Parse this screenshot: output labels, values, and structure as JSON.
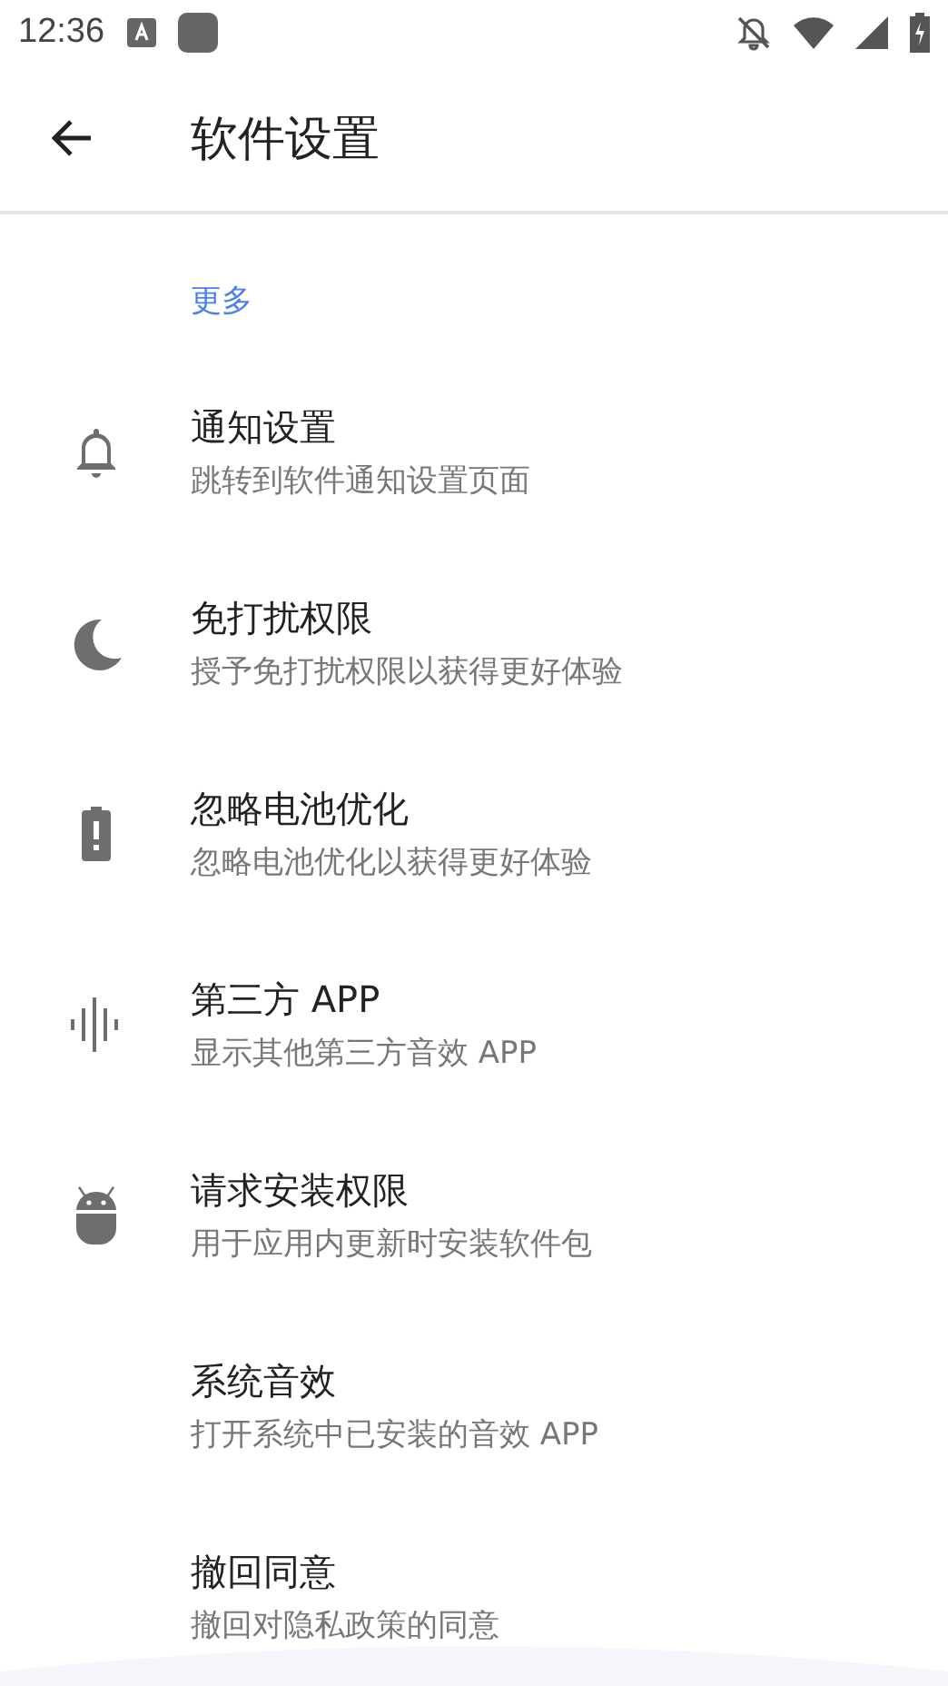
{
  "status_bar": {
    "time": "12:36"
  },
  "toolbar": {
    "title": "软件设置"
  },
  "section": {
    "header": "更多"
  },
  "items": [
    {
      "kind": "bell",
      "title": "通知设置",
      "subtitle": "跳转到软件通知设置页面"
    },
    {
      "kind": "moon",
      "title": "免打扰权限",
      "subtitle": "授予免打扰权限以获得更好体验"
    },
    {
      "kind": "battery",
      "title": "忽略电池优化",
      "subtitle": "忽略电池优化以获得更好体验"
    },
    {
      "kind": "wave",
      "title": "第三方 APP",
      "subtitle": "显示其他第三方音效 APP"
    },
    {
      "kind": "android",
      "title": "请求安装权限",
      "subtitle": "用于应用内更新时安装软件包"
    },
    {
      "kind": "plain",
      "title": "系统音效",
      "subtitle": "打开系统中已安装的音效 APP"
    },
    {
      "kind": "plain",
      "title": "撤回同意",
      "subtitle": "撤回对隐私政策的同意"
    }
  ]
}
